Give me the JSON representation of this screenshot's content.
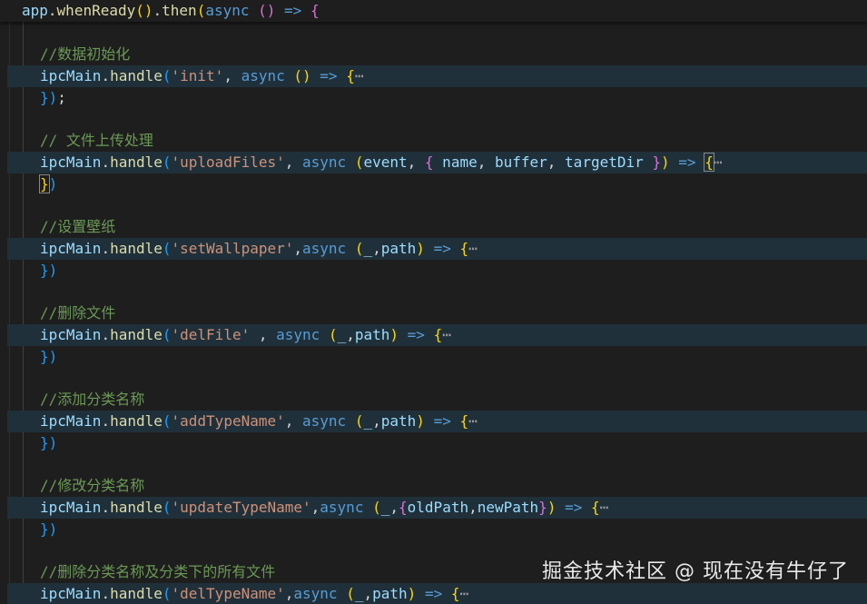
{
  "editor": {
    "header": {
      "obj": "app",
      "method1": "whenReady",
      "method2": "then",
      "kw": "async",
      "arrow": "=>",
      "open": "{"
    },
    "blocks": [
      {
        "comment": "//数据初始化",
        "obj": "ipcMain",
        "method": "handle",
        "channel": "'init'",
        "sep": ", ",
        "kw": "async",
        "params": "()",
        "arrow": "=>",
        "fold": "{⋯",
        "close": "});"
      },
      {
        "comment": "// 文件上传处理",
        "obj": "ipcMain",
        "method": "handle",
        "channel": "'uploadFiles'",
        "sep": ", ",
        "kw": "async",
        "params": "(event, { name, buffer, targetDir })",
        "arrow": "=>",
        "fold": "{⋯",
        "close": "})"
      },
      {
        "comment": "//设置壁纸",
        "obj": "ipcMain",
        "method": "handle",
        "channel": "'setWallpaper'",
        "sep": ",",
        "kw": "async",
        "params": "(_,path)",
        "arrow": "=>",
        "fold": "{⋯",
        "close": "})"
      },
      {
        "comment": "//删除文件",
        "obj": "ipcMain",
        "method": "handle",
        "channel": "'delFile'",
        "sep": " , ",
        "kw": "async",
        "params": "(_,path)",
        "arrow": "=>",
        "fold": "{⋯",
        "close": "})"
      },
      {
        "comment": "//添加分类名称",
        "obj": "ipcMain",
        "method": "handle",
        "channel": "'addTypeName'",
        "sep": ", ",
        "kw": "async",
        "params": "(_,path)",
        "arrow": "=>",
        "fold": "{⋯",
        "close": "})"
      },
      {
        "comment": "//修改分类名称",
        "obj": "ipcMain",
        "method": "handle",
        "channel": "'updateTypeName'",
        "sep": ",",
        "kw": "async",
        "params": "(_,{oldPath,newPath})",
        "arrow": "=>",
        "fold": "{⋯",
        "close": "})"
      },
      {
        "comment": "//删除分类名称及分类下的所有文件",
        "obj": "ipcMain",
        "method": "handle",
        "channel": "'delTypeName'",
        "sep": ",",
        "kw": "async",
        "params": "(_,path)",
        "arrow": "=>",
        "fold": "{⋯",
        "close": ""
      }
    ]
  },
  "watermark": "掘金技术社区 @ 现在没有牛仔了",
  "colors": {
    "background": "#1e1e1e",
    "comment": "#6a9955",
    "function": "#dcdcaa",
    "variable": "#9cdcfe",
    "string": "#ce9178",
    "keyword": "#569cd6",
    "bracket_gold": "#ffd700",
    "bracket_orchid": "#da70d6",
    "bracket_blue": "#179fff",
    "line_highlight": "#20303a"
  }
}
